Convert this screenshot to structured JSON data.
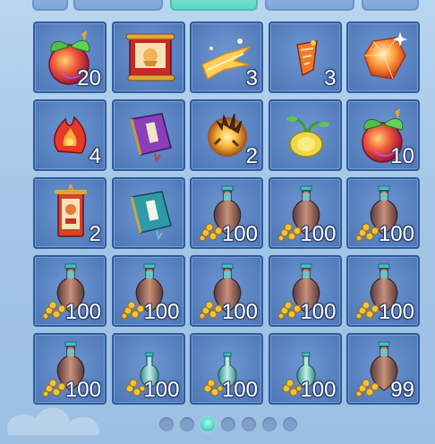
{
  "tabs": [
    {
      "state": "normal"
    },
    {
      "state": "normal"
    },
    {
      "state": "active"
    },
    {
      "state": "normal"
    },
    {
      "state": "normal"
    }
  ],
  "inventory": {
    "slots": [
      {
        "icon": "peach-fruit-icon",
        "count": "20"
      },
      {
        "icon": "scroll-painting-icon",
        "count": ""
      },
      {
        "icon": "golden-feather-icon",
        "count": "3"
      },
      {
        "icon": "talisman-shard-icon",
        "count": "3"
      },
      {
        "icon": "crystal-gem-icon",
        "count": ""
      },
      {
        "icon": "fire-charm-icon",
        "count": "4"
      },
      {
        "icon": "purple-book-icon",
        "count": ""
      },
      {
        "icon": "flaming-orb-icon",
        "count": "2"
      },
      {
        "icon": "golden-gourd-icon",
        "count": ""
      },
      {
        "icon": "peach-fruit-icon",
        "count": "10"
      },
      {
        "icon": "hanging-scroll-icon",
        "count": "2"
      },
      {
        "icon": "teal-book-icon",
        "count": ""
      },
      {
        "icon": "coin-vase-icon",
        "count": "100"
      },
      {
        "icon": "coin-vase-icon",
        "count": "100"
      },
      {
        "icon": "coin-vase-icon",
        "count": "100"
      },
      {
        "icon": "coin-vase-icon",
        "count": "100"
      },
      {
        "icon": "coin-vase-icon",
        "count": "100"
      },
      {
        "icon": "coin-vase-icon",
        "count": "100"
      },
      {
        "icon": "coin-vase-icon",
        "count": "100"
      },
      {
        "icon": "coin-vase-icon",
        "count": "100"
      },
      {
        "icon": "coin-vase-icon",
        "count": "100"
      },
      {
        "icon": "small-coin-vase-icon",
        "count": "100"
      },
      {
        "icon": "small-coin-vase-icon",
        "count": "100"
      },
      {
        "icon": "small-coin-vase-icon",
        "count": "100"
      },
      {
        "icon": "coin-vase-icon",
        "count": "99"
      }
    ]
  },
  "pager": {
    "total_pages": 7,
    "current_page": 3
  },
  "colors": {
    "panel_bg": "#a4c6e6",
    "slot_bg": "#5b84c2",
    "slot_border": "#2f5a9a",
    "active_accent": "#52d6c6"
  }
}
